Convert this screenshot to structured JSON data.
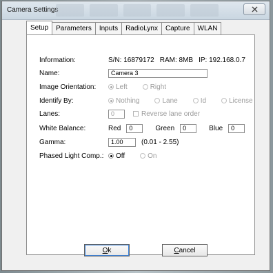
{
  "window": {
    "title": "Camera Settings"
  },
  "tabs": [
    "Setup",
    "Parameters",
    "Inputs",
    "RadioLynx",
    "Capture",
    "WLAN"
  ],
  "setup": {
    "information": {
      "label": "Information:",
      "serial": "S/N: 16879172",
      "ram": "RAM: 8MB",
      "ip": "IP: 192.168.0.7"
    },
    "name": {
      "label": "Name:",
      "value": "Camera 3"
    },
    "image_orientation": {
      "label": "Image Orientation:",
      "options": [
        "Left",
        "Right"
      ],
      "selected": "Left"
    },
    "identify_by": {
      "label": "Identify By:",
      "options": [
        "Nothing",
        "Lane",
        "Id",
        "License"
      ],
      "selected": "Nothing"
    },
    "lanes": {
      "label": "Lanes:",
      "value": "0",
      "reverse_label": "Reverse lane order"
    },
    "white_balance": {
      "label": "White Balance:",
      "red_label": "Red",
      "red_value": "0",
      "green_label": "Green",
      "green_value": "0",
      "blue_label": "Blue",
      "blue_value": "0"
    },
    "gamma": {
      "label": "Gamma:",
      "value": "1.00",
      "range": "(0.01 - 2.55)"
    },
    "phased_light": {
      "label": "Phased Light Comp.:",
      "options": [
        "Off",
        "On"
      ],
      "selected": "Off"
    }
  },
  "buttons": {
    "ok_prefix": "O",
    "ok_suffix": "k",
    "cancel_prefix": "C",
    "cancel_suffix": "ancel"
  },
  "colors": {
    "titlebar": "#c9d6e1",
    "panel": "#ffffff",
    "window": "#f0f0f0"
  }
}
